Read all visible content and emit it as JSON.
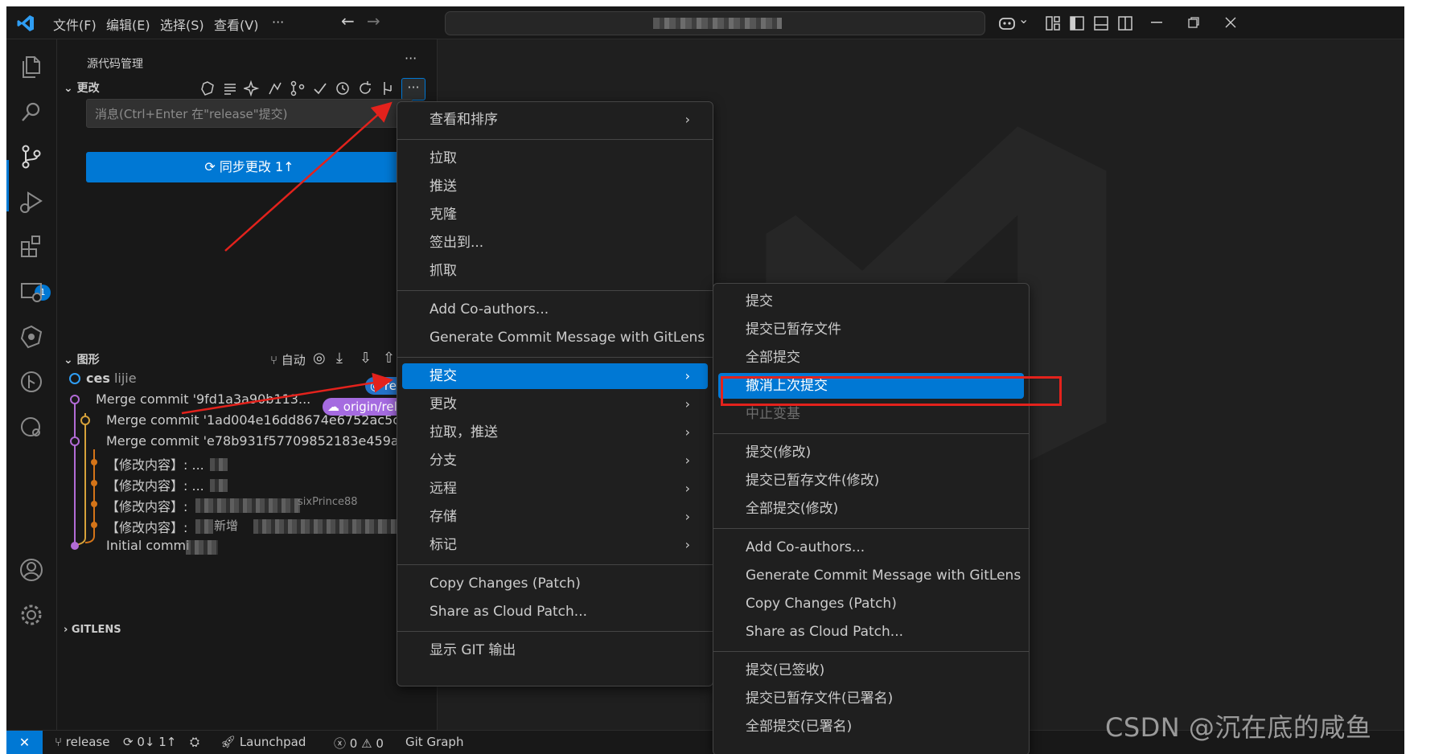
{
  "titlebar": {
    "menus": [
      "文件(F)",
      "编辑(E)",
      "选择(S)",
      "查看(V)",
      "···"
    ],
    "nav_back": "←",
    "nav_forward": "→",
    "copilot": "⌄"
  },
  "activity": {
    "extensions_badge": "1"
  },
  "sidebar": {
    "title": "源代码管理",
    "more": "···",
    "changes_header": "更改",
    "message_placeholder": "消息(Ctrl+Enter 在\"release\"提交)",
    "sync_button": "同步更改 1↑",
    "graph_header": "图形",
    "graph_auto": "自动",
    "graph_rows": [
      {
        "name": "ces",
        "author": "lijie",
        "tag": "rele"
      },
      {
        "text": "Merge commit '9fd1a3a90b113...",
        "tag": "origin/rele"
      },
      {
        "text": "Merge commit '1ad004e16dd8674e6752ac5c"
      },
      {
        "text": "Merge commit 'e78b931f57709852183e459a"
      },
      {
        "text": "【修改内容】: ..."
      },
      {
        "text": "【修改内容】: ..."
      },
      {
        "text": "【修改内容】:",
        "suffix": "sixPrince88"
      },
      {
        "text": "【修改内容】:",
        "suffix": "新增"
      },
      {
        "text": "Initial commi"
      }
    ],
    "gitlens_header": "GITLENS"
  },
  "menu1": {
    "items": [
      {
        "label": "查看和排序",
        "submenu": true
      },
      {
        "label": "拉取"
      },
      {
        "label": "推送"
      },
      {
        "label": "克隆"
      },
      {
        "label": "签出到..."
      },
      {
        "label": "抓取"
      },
      {
        "label": "Add Co-authors..."
      },
      {
        "label": "Generate Commit Message with GitLens"
      },
      {
        "label": "提交",
        "submenu": true,
        "selected": true
      },
      {
        "label": "更改",
        "submenu": true
      },
      {
        "label": "拉取，推送",
        "submenu": true
      },
      {
        "label": "分支",
        "submenu": true
      },
      {
        "label": "远程",
        "submenu": true
      },
      {
        "label": "存储",
        "submenu": true
      },
      {
        "label": "标记",
        "submenu": true
      },
      {
        "label": "Copy Changes (Patch)"
      },
      {
        "label": "Share as Cloud Patch..."
      },
      {
        "label": "显示 GIT 输出"
      }
    ]
  },
  "menu2": {
    "items": [
      {
        "label": "提交"
      },
      {
        "label": "提交已暂存文件"
      },
      {
        "label": "全部提交"
      },
      {
        "label": "撤消上次提交",
        "selected": true
      },
      {
        "label": "中止变基",
        "disabled": true
      },
      {
        "label": "提交(修改)"
      },
      {
        "label": "提交已暂存文件(修改)"
      },
      {
        "label": "全部提交(修改)"
      },
      {
        "label": "Add Co-authors..."
      },
      {
        "label": "Generate Commit Message with GitLens"
      },
      {
        "label": "Copy Changes (Patch)"
      },
      {
        "label": "Share as Cloud Patch..."
      },
      {
        "label": "提交(已签收)"
      },
      {
        "label": "提交已暂存文件(已署名)"
      },
      {
        "label": "全部提交(已署名)"
      }
    ]
  },
  "statusbar": {
    "remote": "✕",
    "branch": "release",
    "sync": "0↓ 1↑",
    "launchpad": "Launchpad",
    "errors": "0",
    "warnings": "0",
    "git_graph": "Git Graph"
  },
  "watermark": "CSDN @沉在底的咸鱼",
  "colors": {
    "accent": "#0078d4",
    "annotation": "#e3221c",
    "tag_blue": "#2472c8",
    "tag_purple": "#a56be0"
  }
}
